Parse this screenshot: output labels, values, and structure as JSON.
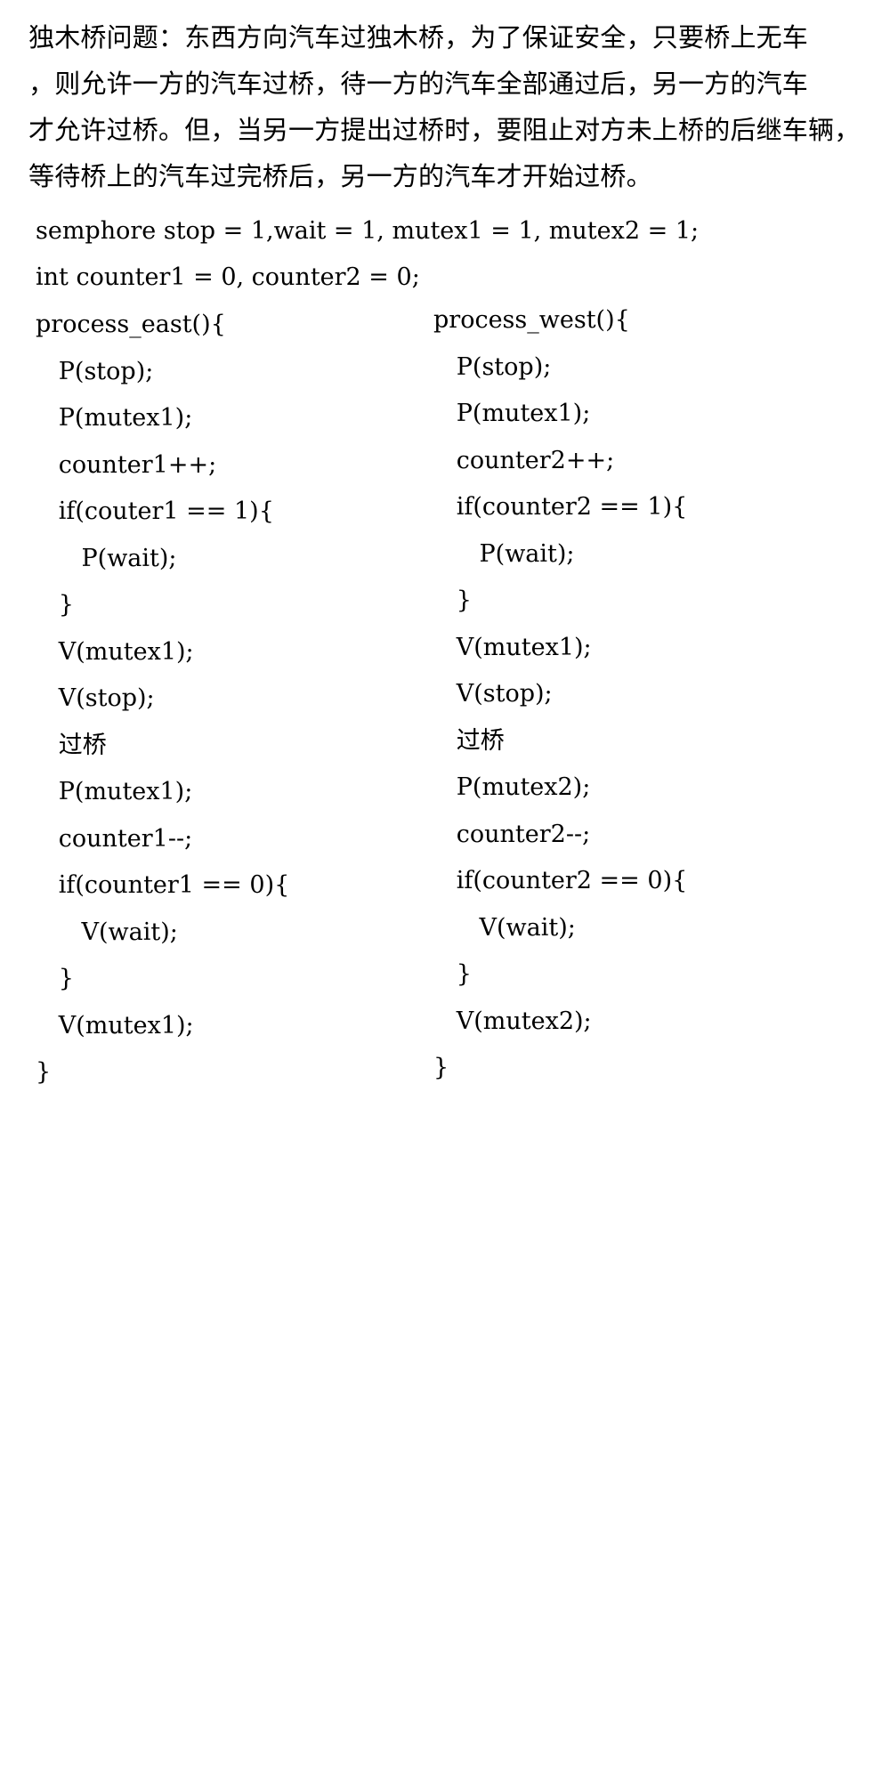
{
  "intro": [
    "独木桥问题：东西方向汽车过独木桥，为了保证安全，只要桥上无车",
    "，则允许一方的汽车过桥，待一方的汽车全部通过后，另一方的汽车",
    "才允许过桥。但，当另一方提出过桥时，要阻止对方未上桥的后继车辆，",
    "等待桥上的汽车过完桥后，另一方的汽车才开始过桥。"
  ],
  "declarations": [
    "semphore stop = 1,wait = 1, mutex1 = 1, mutex2 = 1;",
    "int counter1 = 0, counter2 = 0;"
  ],
  "process_east": [
    "process_east(){",
    "   P(stop);",
    "   P(mutex1);",
    "   counter1++;",
    "   if(couter1 == 1){",
    "      P(wait);",
    "   }",
    "   V(mutex1);",
    "   V(stop);",
    "   过桥",
    "   P(mutex1);",
    "   counter1--;",
    "   if(counter1 == 0){",
    "      V(wait);",
    "   }",
    "   V(mutex1);",
    "}"
  ],
  "process_west": [
    "process_west(){",
    "   P(stop);",
    "   P(mutex1);",
    "   counter2++;",
    "   if(counter2 == 1){",
    "      P(wait);",
    "   }",
    "   V(mutex1);",
    "   V(stop);",
    "   过桥",
    "   P(mutex2);",
    "   counter2--;",
    "   if(counter2 == 0){",
    "      V(wait);",
    "   }",
    "   V(mutex2);",
    "}"
  ]
}
